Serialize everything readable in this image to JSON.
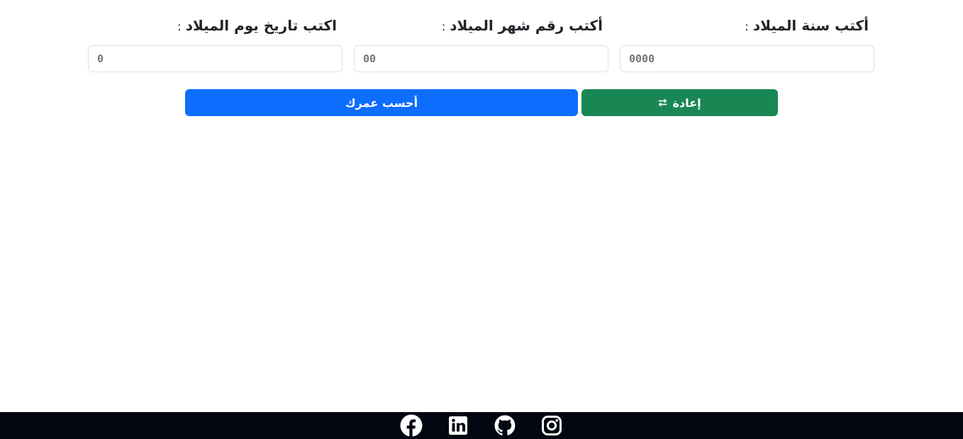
{
  "form": {
    "colon": ":",
    "year": {
      "label": "أكتب سنة الميلاد",
      "placeholder": "0000"
    },
    "month": {
      "label": "أكتب رقم شهر الميلاد",
      "placeholder": "00"
    },
    "day": {
      "label": "اكتب تاريخ يوم الميلاد",
      "placeholder": "0"
    }
  },
  "buttons": {
    "reset_label": "إعادة",
    "reset_icon": "⮂",
    "calculate_label": "أحسب عمرك"
  },
  "colors": {
    "primary": "#0d6efd",
    "success": "#198754",
    "footer_bg": "#030712"
  },
  "footer": {
    "icons": [
      "instagram-icon",
      "github-icon",
      "linkedin-icon",
      "facebook-icon"
    ]
  }
}
